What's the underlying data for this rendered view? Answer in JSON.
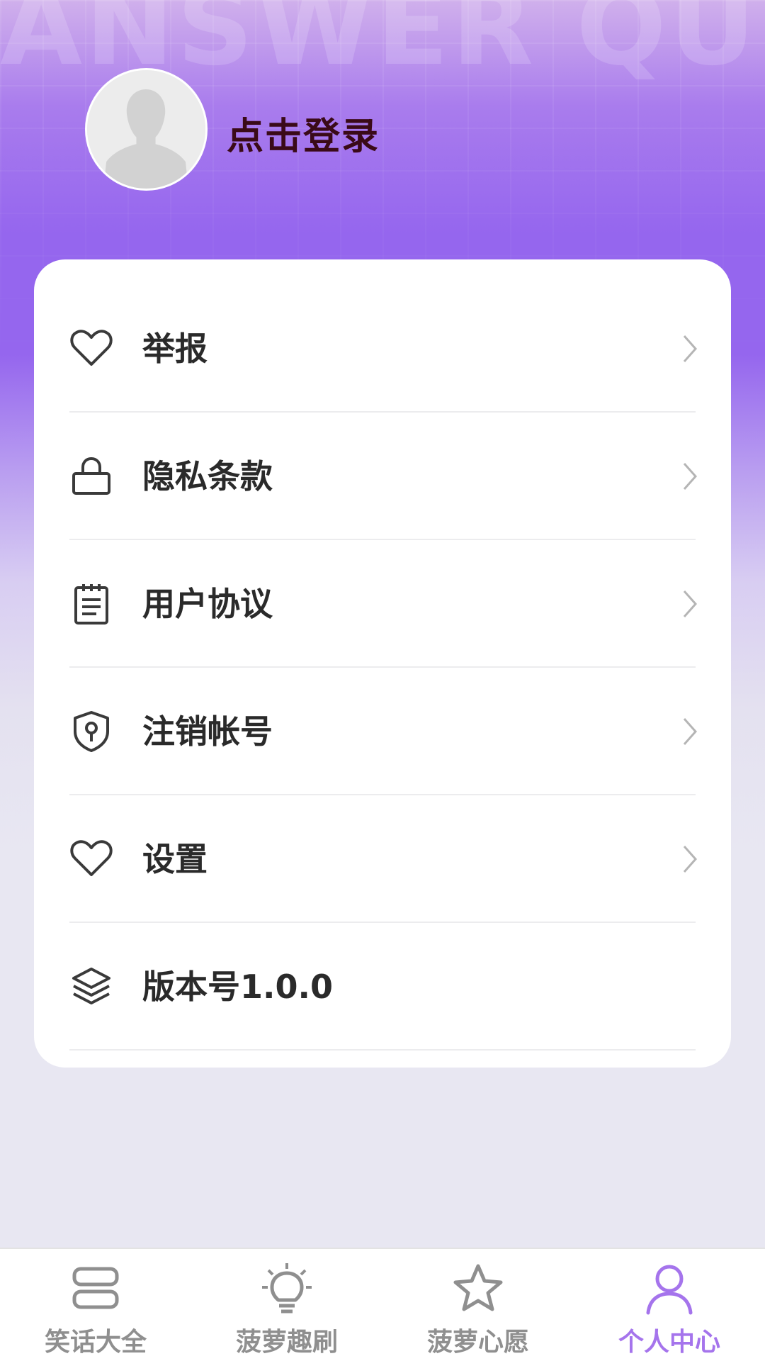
{
  "background": {
    "watermark": "ANSWER QUE"
  },
  "profile": {
    "login_label": "点击登录"
  },
  "menu": {
    "items": [
      {
        "label": "举报",
        "icon": "heart-icon",
        "has_arrow": true
      },
      {
        "label": "隐私条款",
        "icon": "lock-icon",
        "has_arrow": true
      },
      {
        "label": "用户协议",
        "icon": "document-icon",
        "has_arrow": true
      },
      {
        "label": "注销帐号",
        "icon": "shield-key-icon",
        "has_arrow": true
      },
      {
        "label": "设置",
        "icon": "heart-icon",
        "has_arrow": true
      },
      {
        "label": "版本号1.0.0",
        "icon": "layers-icon",
        "has_arrow": false
      }
    ]
  },
  "tabbar": {
    "tabs": [
      {
        "label": "笑话大全",
        "icon": "stack-icon",
        "active": false
      },
      {
        "label": "菠萝趣刷",
        "icon": "lightbulb-icon",
        "active": false
      },
      {
        "label": "菠萝心愿",
        "icon": "star-icon",
        "active": false
      },
      {
        "label": "个人中心",
        "icon": "person-icon",
        "active": true
      }
    ]
  },
  "colors": {
    "accent": "#a574ec",
    "header_purple": "#9566ee",
    "page_bg": "#e8e7f2",
    "login_text": "#3a0a18",
    "inactive_tab": "#8f8f8f"
  }
}
